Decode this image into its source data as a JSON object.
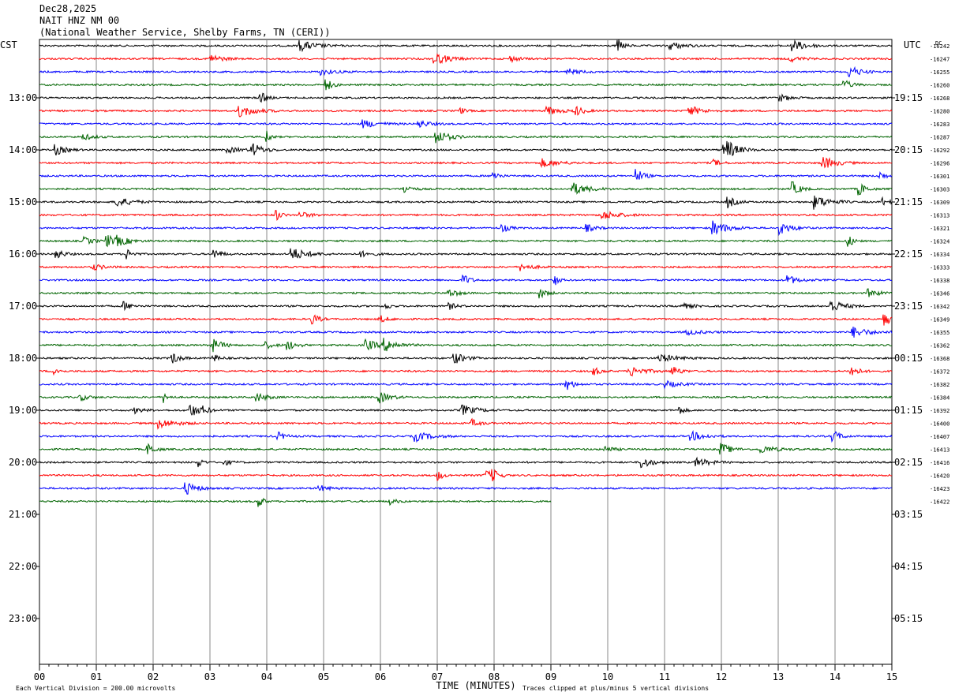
{
  "header": {
    "date": "Dec28,2025",
    "station": "NAIT HNZ NM 00",
    "location": "(National Weather Service, Shelby Farms, TN (CERI))"
  },
  "axes": {
    "left_label": "CST",
    "right_label": "UTC",
    "dc_label": "DC",
    "x_title": "TIME (MINUTES)",
    "x_ticks": [
      "00",
      "01",
      "02",
      "03",
      "04",
      "05",
      "06",
      "07",
      "08",
      "09",
      "10",
      "11",
      "12",
      "13",
      "14",
      "15"
    ],
    "left_hours": [
      "13:00",
      "14:00",
      "15:00",
      "16:00",
      "17:00",
      "18:00",
      "19:00",
      "20:00",
      "21:00",
      "22:00",
      "23:00"
    ],
    "right_hours": [
      "19:15",
      "20:15",
      "21:15",
      "22:15",
      "23:15",
      "00:15",
      "01:15",
      "02:15",
      "03:15",
      "04:15",
      "05:15"
    ]
  },
  "footer": {
    "scale_note": "Each Vertical Division =  200.00 microvolts",
    "clip_note": "Traces clipped at plus/minus 5 vertical divisions"
  },
  "colors": {
    "cycle": [
      "#000000",
      "#ff0000",
      "#0000ff",
      "#006400"
    ],
    "grid": "#888888"
  },
  "chart_data": {
    "type": "line",
    "title": "NAIT HNZ NM 00",
    "xlabel": "TIME (MINUTES)",
    "xlim": [
      0,
      15
    ],
    "traces_per_hour": 4,
    "trace_minutes": 15,
    "dc_offsets": [
      -16242,
      -16247,
      -16255,
      -16260,
      -16268,
      -16280,
      -16283,
      -16287,
      -16292,
      -16296,
      -16301,
      -16303,
      -16309,
      -16313,
      -16321,
      -16324,
      -16334,
      -16333,
      -16338,
      -16346,
      -16342,
      -16349,
      -16355,
      -16362,
      -16368,
      -16372,
      -16382,
      -16384,
      -16392,
      -16400,
      -16407,
      -16413,
      -16416,
      -16420,
      -16423,
      -16422
    ],
    "last_trace_end_minute": 9
  }
}
